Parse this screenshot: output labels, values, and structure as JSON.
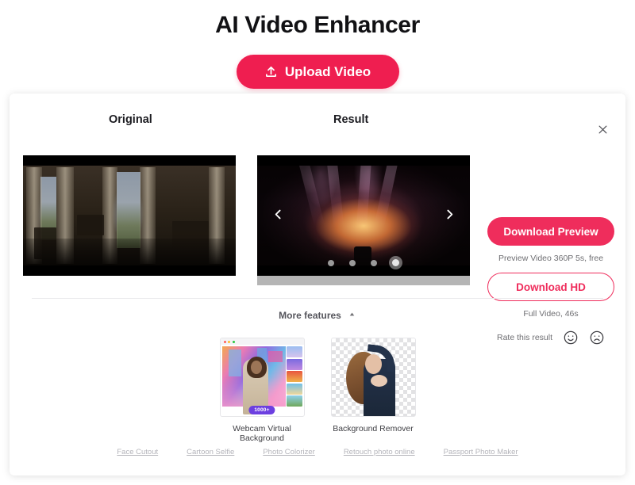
{
  "hero": {
    "title": "AI Video Enhancer",
    "upload_label": "Upload Video",
    "upload_icon": "upload-icon"
  },
  "card": {
    "close_icon": "close-icon",
    "panels": {
      "original_label": "Original",
      "result_label": "Result"
    },
    "carousel": {
      "prev_icon": "chevron-left-icon",
      "next_icon": "chevron-right-icon",
      "dot_count": 4,
      "active_dot_index": 3
    },
    "actions": {
      "download_preview_label": "Download Preview",
      "preview_caption": "Preview Video 360P 5s, free",
      "download_hd_label": "Download HD",
      "hd_caption": "Full Video, 46s",
      "rate_label": "Rate this result",
      "rate_good_icon": "smiley-face-icon",
      "rate_bad_icon": "frowny-face-icon"
    },
    "more_features": {
      "label": "More features",
      "caret_icon": "chevron-up-icon"
    },
    "features": [
      {
        "caption": "Webcam Virtual Background",
        "badge": "1000+"
      },
      {
        "caption": "Background Remover",
        "badge": ""
      }
    ],
    "links": [
      "Face Cutout",
      "Cartoon Selfie",
      "Photo Colorizer",
      "Retouch photo online",
      "Passport Photo Maker"
    ]
  },
  "colors": {
    "accent": "#ef1e50",
    "accent_alt": "#ef2d5c",
    "badge_purple": "#6c3fe0",
    "muted_text": "#6e6e72",
    "link_gray": "#b4b4ba"
  }
}
